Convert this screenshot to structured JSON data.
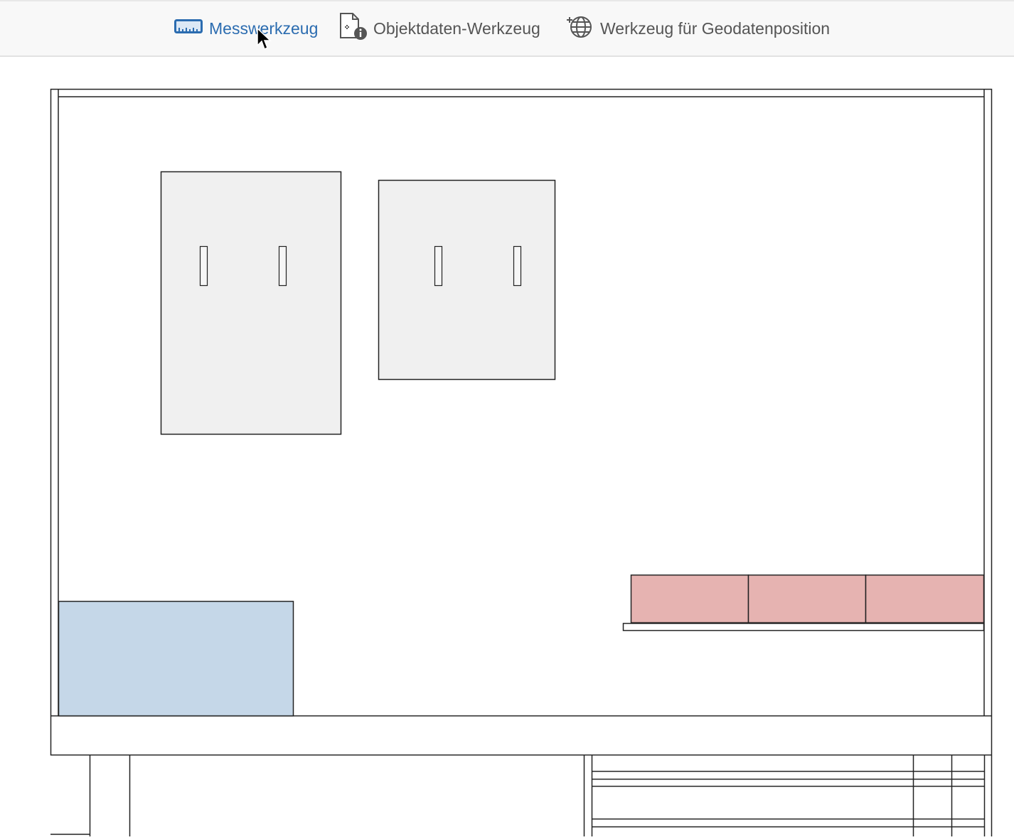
{
  "toolbar": {
    "tools": [
      {
        "label": "Messwerkzeug",
        "icon": "ruler-icon",
        "active": true
      },
      {
        "label": "Objektdaten-Werkzeug",
        "icon": "document-info-icon",
        "active": false
      },
      {
        "label": "Werkzeug für Geodatenposition",
        "icon": "globe-add-icon",
        "active": false
      }
    ]
  },
  "colors": {
    "active_tool": "#2b6cb0",
    "inactive_tool": "#555555",
    "panel_fill": "#f0f0f0",
    "blue_fill": "#c5d7e8",
    "red_fill": "#e6b3b1",
    "line": "#222222"
  }
}
